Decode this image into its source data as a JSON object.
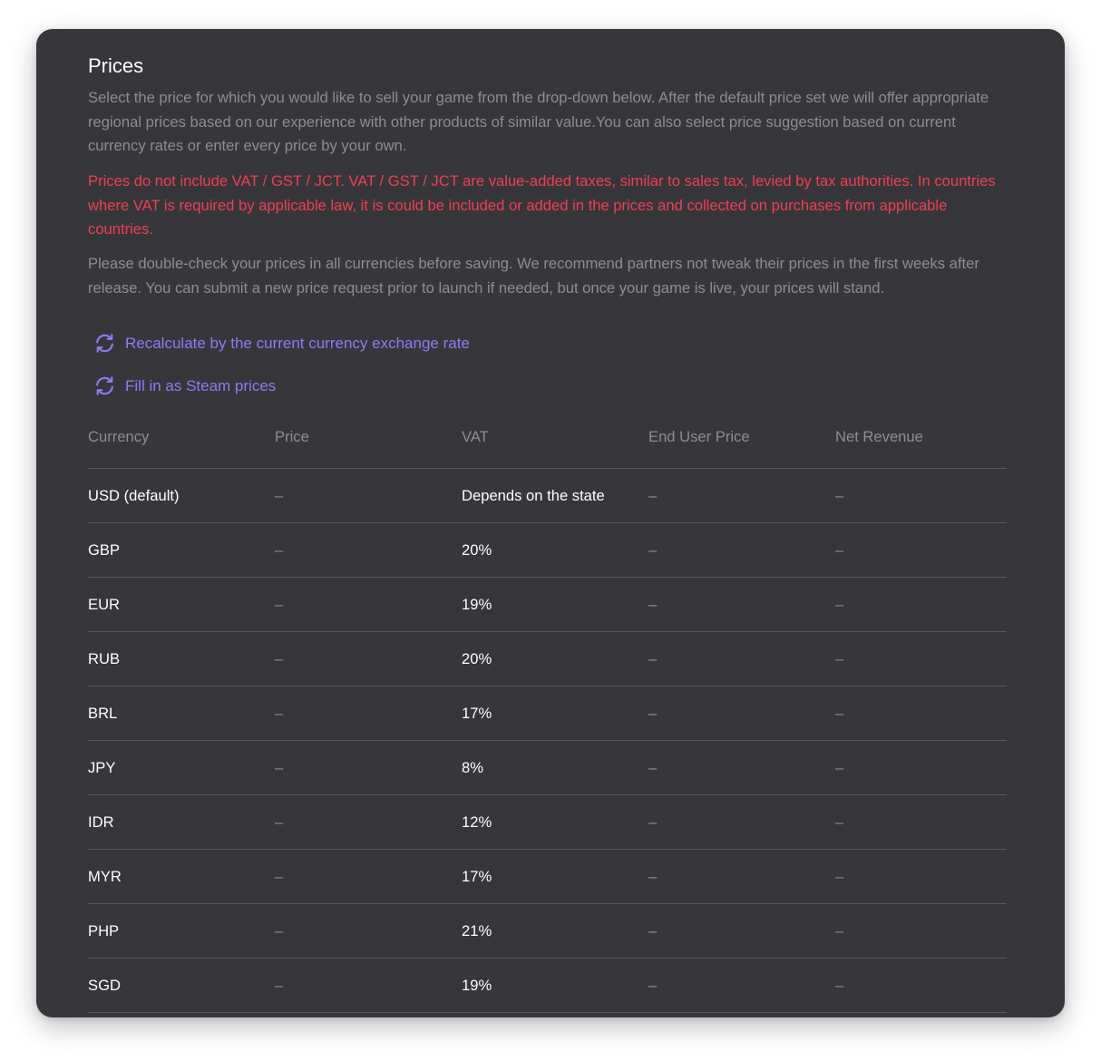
{
  "section": {
    "title": "Prices",
    "description": "Select the price for which you would like to sell your game from the drop-down below. After the default price set we will offer appropriate regional prices based on our experience with other products of similar value.You can also select price suggestion based on current currency rates or enter every price by your own.",
    "vat_warning": "Prices do not include VAT / GST / JCT. VAT / GST / JCT are value-added taxes, similar to sales tax, levied by tax authorities. In countries where VAT is required by applicable law, it is could be included or added in the prices and collected on purchases from applicable countries.",
    "notice": "Please double-check your prices in all currencies before saving. We recommend partners not tweak their prices in the first weeks after release. You can submit a new price request prior to launch if needed, but once your game is live, your prices will stand."
  },
  "actions": {
    "recalculate_label": "Recalculate by the current currency exchange rate",
    "steam_label": "Fill in as Steam prices",
    "icon": "refresh-icon"
  },
  "colors": {
    "card_background": "#36363b",
    "warning": "#ee4050",
    "accent": "#8e7cf4",
    "muted_text": "#8d8d93"
  },
  "table": {
    "headers": [
      "Currency",
      "Price",
      "VAT",
      "End User Price",
      "Net Revenue"
    ],
    "rows": [
      {
        "currency": "USD (default)",
        "price": "–",
        "vat": "Depends on the state",
        "end_user_price": "–",
        "net_revenue": "–"
      },
      {
        "currency": "GBP",
        "price": "–",
        "vat": "20%",
        "end_user_price": "–",
        "net_revenue": "–"
      },
      {
        "currency": "EUR",
        "price": "–",
        "vat": "19%",
        "end_user_price": "–",
        "net_revenue": "–"
      },
      {
        "currency": "RUB",
        "price": "–",
        "vat": "20%",
        "end_user_price": "–",
        "net_revenue": "–"
      },
      {
        "currency": "BRL",
        "price": "–",
        "vat": "17%",
        "end_user_price": "–",
        "net_revenue": "–"
      },
      {
        "currency": "JPY",
        "price": "–",
        "vat": "8%",
        "end_user_price": "–",
        "net_revenue": "–"
      },
      {
        "currency": "IDR",
        "price": "–",
        "vat": "12%",
        "end_user_price": "–",
        "net_revenue": "–"
      },
      {
        "currency": "MYR",
        "price": "–",
        "vat": "17%",
        "end_user_price": "–",
        "net_revenue": "–"
      },
      {
        "currency": "PHP",
        "price": "–",
        "vat": "21%",
        "end_user_price": "–",
        "net_revenue": "–"
      },
      {
        "currency": "SGD",
        "price": "–",
        "vat": "19%",
        "end_user_price": "–",
        "net_revenue": "–"
      }
    ]
  }
}
